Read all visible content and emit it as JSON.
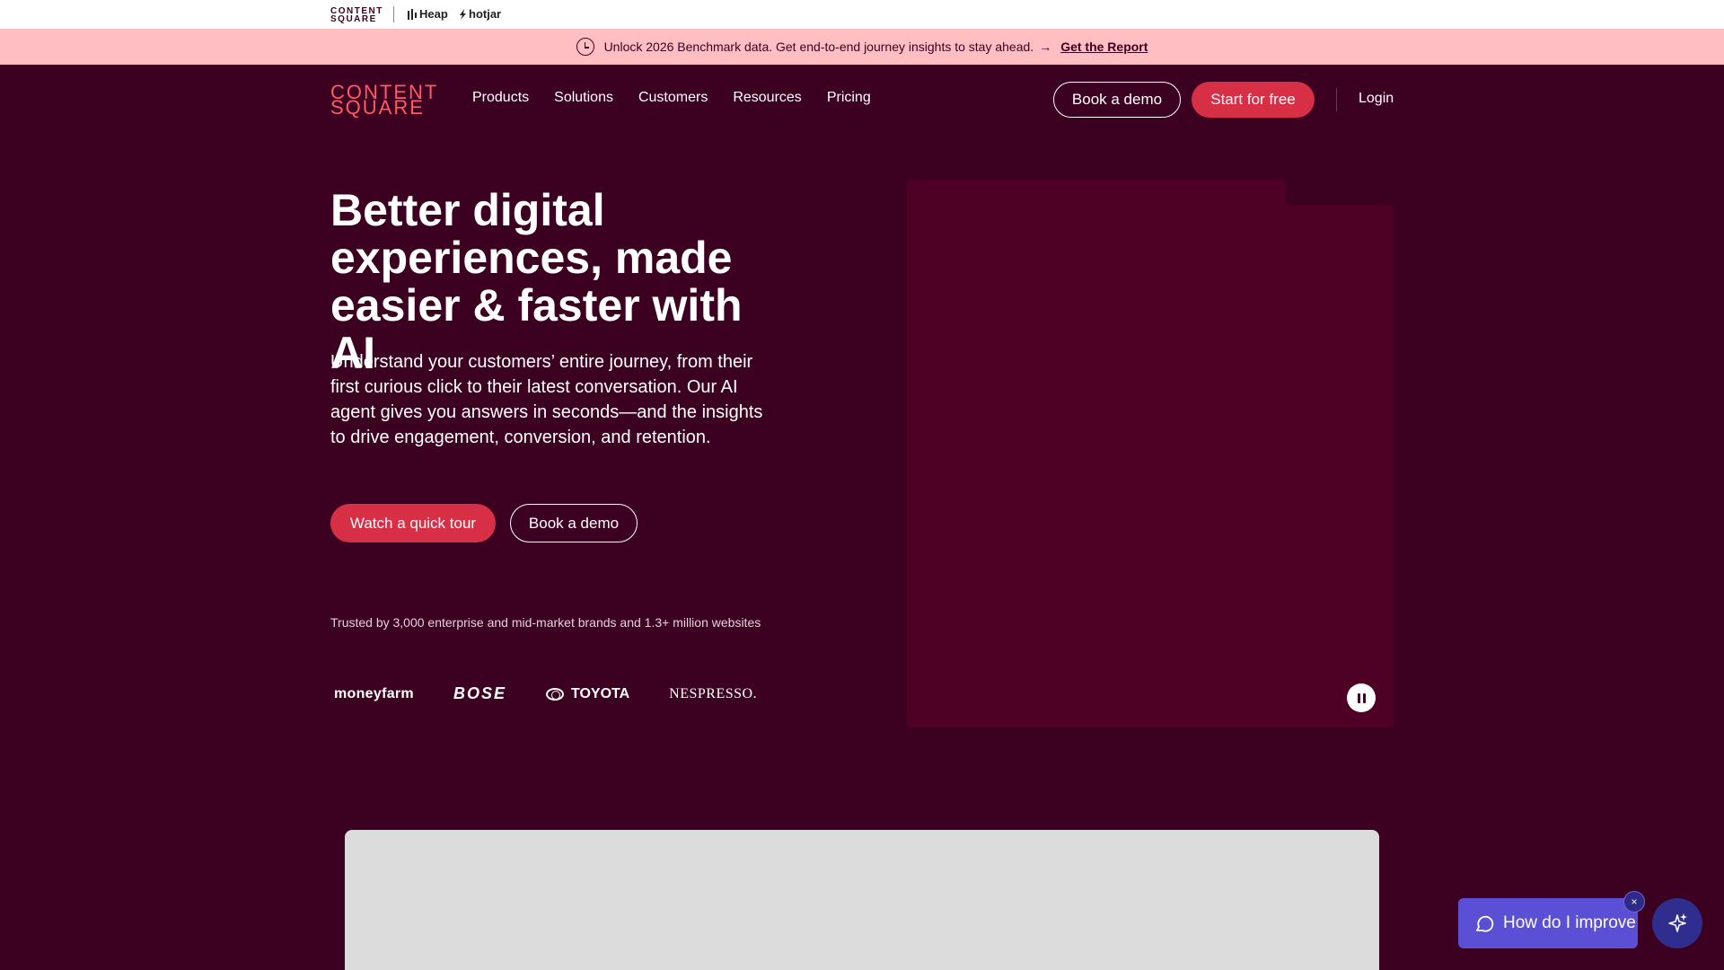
{
  "brand_strip": {
    "contentsquare_line1": "CONTENT",
    "contentsquare_line2": "SQUARE",
    "heap": "Heap",
    "hotjar": "hotjar"
  },
  "announcement": {
    "text": "Unlock 2026 Benchmark data. Get end-to-end journey insights to stay ahead.",
    "arrow": "→",
    "link_label": "Get the Report"
  },
  "header": {
    "logo_line1": "CONTENT",
    "logo_line2": "SQUARE",
    "nav": [
      "Products",
      "Solutions",
      "Customers",
      "Resources",
      "Pricing"
    ],
    "book_demo": "Book a demo",
    "start_free": "Start for free",
    "login": "Login"
  },
  "hero": {
    "title": "Better digital experiences, made easier & faster with AI",
    "subtitle": "Understand your customers’ entire journey, from their first curious click to their latest conversation. Our AI agent gives you answers in seconds—and the insights to drive engagement, conversion, and retention.",
    "cta_primary": "Watch a quick tour",
    "cta_secondary": "Book a demo",
    "trusted": "Trusted by 3,000 enterprise and mid-market brands and 1.3+ million websites",
    "logos": [
      "moneyfarm",
      "BOSE",
      "TOYOTA",
      "NESPRESSO."
    ]
  },
  "chat": {
    "label": "How do I improve",
    "close": "×"
  },
  "colors": {
    "background": "#3c0020",
    "accent": "#d62f46",
    "announcement": "#ffbfc2",
    "logo": "#ff5a66",
    "chat": "#5b4fd6"
  }
}
